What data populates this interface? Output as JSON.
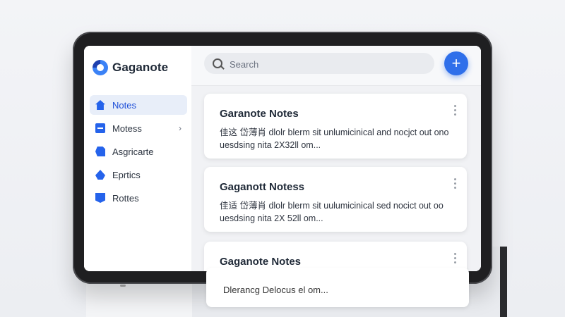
{
  "app": {
    "name": "Gaganote"
  },
  "sidebar": {
    "items": [
      {
        "label": "Notes",
        "icon": "home-icon",
        "active": true
      },
      {
        "label": "Motess",
        "icon": "folder-icon",
        "has_chevron": true
      },
      {
        "label": "Asgricarte",
        "icon": "document-icon"
      },
      {
        "label": "Eprtics",
        "icon": "drop-icon"
      },
      {
        "label": "Rottes",
        "icon": "badge-icon"
      }
    ]
  },
  "search": {
    "placeholder": "Search"
  },
  "fab": {
    "label": "+"
  },
  "notes": [
    {
      "title": "Garanote Notes",
      "snippet": "佳这 岱薄肖 dlolr blerm sit unlumicinical and nocjct out ono uesdsing nita 2X32ll om..."
    },
    {
      "title": "Gaganott Notess",
      "snippet": "佳适 岱薄肖 dlolr blerm sit uulumicinical sed nocict out oo uesdsing nita 2X 52ll om..."
    },
    {
      "title": "Gaganote Notes",
      "snippet": "Dlerancg Delocus el om..."
    }
  ],
  "colors": {
    "accent": "#2f6fea",
    "active_bg": "#e8eef9",
    "frame": "#1f1f21"
  }
}
